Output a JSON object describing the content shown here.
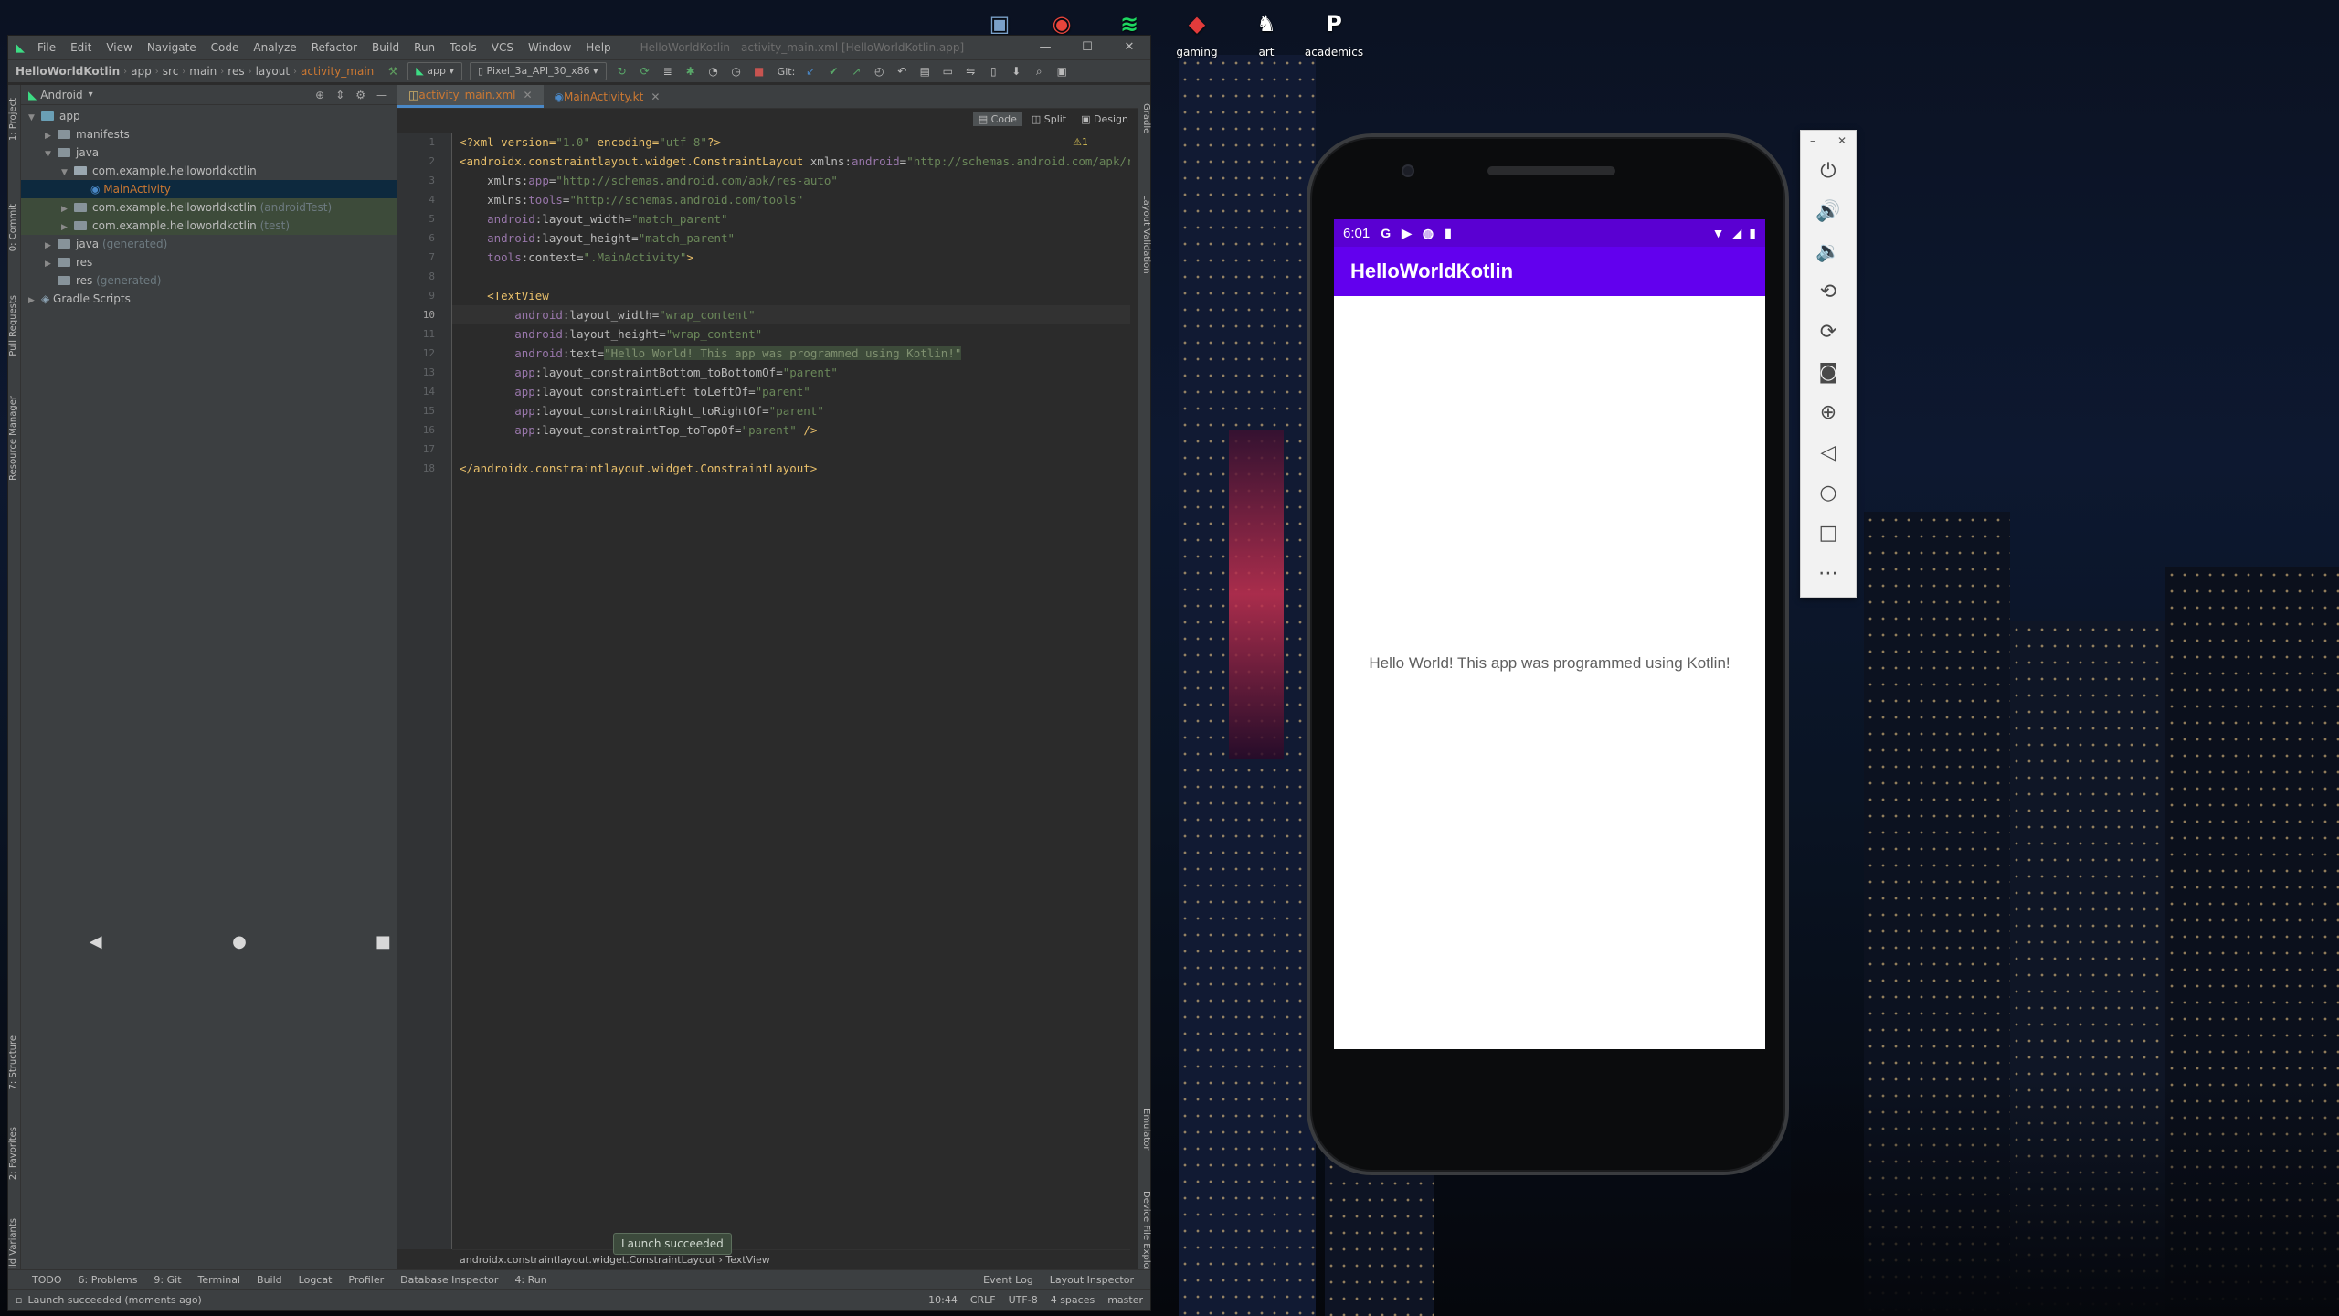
{
  "desktop": {
    "icons": [
      {
        "label": "",
        "glyph": "▣",
        "color": "#7aa0c8",
        "name": "recycle-bin-icon"
      },
      {
        "label": "",
        "glyph": "◉",
        "color": "#e8453c",
        "name": "chrome-icon"
      },
      {
        "label": "",
        "glyph": "≋",
        "color": "#1ed760",
        "name": "spotify-icon"
      },
      {
        "label": "gaming",
        "glyph": "◆",
        "color": "#e23b3b",
        "name": "gaming-icon"
      },
      {
        "label": "art",
        "glyph": "♞",
        "color": "#ffffff",
        "name": "art-icon"
      },
      {
        "label": "academics",
        "glyph": "P",
        "color": "#ffffff",
        "name": "academics-icon"
      }
    ]
  },
  "ide": {
    "menu": [
      "File",
      "Edit",
      "View",
      "Navigate",
      "Code",
      "Analyze",
      "Refactor",
      "Build",
      "Run",
      "Tools",
      "VCS",
      "Window",
      "Help"
    ],
    "title": "HelloWorldKotlin - activity_main.xml [HelloWorldKotlin.app]",
    "window_controls": [
      "—",
      "☐",
      "✕"
    ],
    "breadcrumbs": [
      "HelloWorldKotlin",
      "app",
      "src",
      "main",
      "res",
      "layout",
      "activity_main"
    ],
    "run_config": "app",
    "device": "Pixel_3a_API_30_x86",
    "git_label": "Git:",
    "left_tabs": [
      "1: Project",
      "0: Commit",
      "Pull Requests",
      "Resource Manager",
      "7: Structure",
      "2: Favorites",
      "Build Variants"
    ],
    "right_tabs": [
      "Gradle",
      "Layout Validation",
      "Emulator",
      "Device File Explorer"
    ],
    "project_view": "Android",
    "tree": [
      {
        "indent": 0,
        "arrow": "▼",
        "label": "app",
        "suffix": "",
        "kind": "module"
      },
      {
        "indent": 1,
        "arrow": "▶",
        "label": "manifests",
        "suffix": "",
        "kind": "folder"
      },
      {
        "indent": 1,
        "arrow": "▼",
        "label": "java",
        "suffix": "",
        "kind": "folder"
      },
      {
        "indent": 2,
        "arrow": "▼",
        "label": "com.example.helloworldkotlin",
        "suffix": "",
        "kind": "package"
      },
      {
        "indent": 3,
        "arrow": "",
        "label": "MainActivity",
        "suffix": "",
        "kind": "selected"
      },
      {
        "indent": 2,
        "arrow": "▶",
        "label": "com.example.helloworldkotlin",
        "suffix": " (androidTest)",
        "kind": "test"
      },
      {
        "indent": 2,
        "arrow": "▶",
        "label": "com.example.helloworldkotlin",
        "suffix": " (test)",
        "kind": "test"
      },
      {
        "indent": 1,
        "arrow": "▶",
        "label": "java",
        "suffix": " (generated)",
        "kind": "folder"
      },
      {
        "indent": 1,
        "arrow": "▶",
        "label": "res",
        "suffix": "",
        "kind": "folder"
      },
      {
        "indent": 1,
        "arrow": "",
        "label": "res",
        "suffix": " (generated)",
        "kind": "folder"
      },
      {
        "indent": 0,
        "arrow": "▶",
        "label": "Gradle Scripts",
        "suffix": "",
        "kind": "gradle"
      }
    ],
    "tabs": [
      {
        "label": "activity_main.xml",
        "active": true
      },
      {
        "label": "MainActivity.kt",
        "active": false
      }
    ],
    "view_modes": [
      "Code",
      "Split",
      "Design"
    ],
    "warning_count": "⚠1",
    "current_line": "10",
    "breadcrumb_bar": "androidx.constraintlayout.widget.ConstraintLayout  ›  TextView",
    "launch_tooltip": "Launch succeeded",
    "toolwindows": [
      "TODO",
      "6: Problems",
      "9: Git",
      "Terminal",
      "Build",
      "Logcat",
      "Profiler",
      "Database Inspector",
      "4: Run"
    ],
    "toolwindows_right": [
      "Event Log",
      "Layout Inspector"
    ],
    "status_left": "Launch succeeded (moments ago)",
    "status_right": [
      "10:44",
      "CRLF",
      "UTF-8",
      "4 spaces",
      "master"
    ]
  },
  "code_lines": [
    [
      [
        "tag",
        "<?xml version="
      ],
      [
        "str",
        "\"1.0\""
      ],
      [
        "tag",
        " encoding="
      ],
      [
        "str",
        "\"utf-8\""
      ],
      [
        "tag",
        "?>"
      ]
    ],
    [
      [
        "tag",
        "<androidx.constraintlayout.widget.ConstraintLayout "
      ],
      [
        "attr",
        "xmlns:"
      ],
      [
        "ns",
        "android"
      ],
      [
        "attr",
        "="
      ],
      [
        "str",
        "\"http://schemas.android.com/apk/res/android\""
      ]
    ],
    [
      [
        "attr",
        "    xmlns:"
      ],
      [
        "ns",
        "app"
      ],
      [
        "attr",
        "="
      ],
      [
        "str",
        "\"http://schemas.android.com/apk/res-auto\""
      ]
    ],
    [
      [
        "attr",
        "    xmlns:"
      ],
      [
        "ns",
        "tools"
      ],
      [
        "attr",
        "="
      ],
      [
        "str",
        "\"http://schemas.android.com/tools\""
      ]
    ],
    [
      [
        "ns",
        "    android"
      ],
      [
        "attr",
        ":layout_width="
      ],
      [
        "str",
        "\"match_parent\""
      ]
    ],
    [
      [
        "ns",
        "    android"
      ],
      [
        "attr",
        ":layout_height="
      ],
      [
        "str",
        "\"match_parent\""
      ]
    ],
    [
      [
        "ns",
        "    tools"
      ],
      [
        "attr",
        ":context="
      ],
      [
        "str",
        "\".MainActivity\""
      ],
      [
        "tag",
        ">"
      ]
    ],
    [
      [
        "attr",
        ""
      ]
    ],
    [
      [
        "tag",
        "    <TextView"
      ]
    ],
    [
      [
        "ns",
        "        android"
      ],
      [
        "attr",
        ":layout_width="
      ],
      [
        "str",
        "\"wrap_content\""
      ]
    ],
    [
      [
        "ns",
        "        android"
      ],
      [
        "attr",
        ":layout_height="
      ],
      [
        "str",
        "\"wrap_content\""
      ]
    ],
    [
      [
        "ns",
        "        android"
      ],
      [
        "attr",
        ":text="
      ],
      [
        "hl",
        "\"Hello World! This app was programmed using Kotlin!\""
      ]
    ],
    [
      [
        "ns",
        "        app"
      ],
      [
        "attr",
        ":layout_constraintBottom_toBottomOf="
      ],
      [
        "str",
        "\"parent\""
      ]
    ],
    [
      [
        "ns",
        "        app"
      ],
      [
        "attr",
        ":layout_constraintLeft_toLeftOf="
      ],
      [
        "str",
        "\"parent\""
      ]
    ],
    [
      [
        "ns",
        "        app"
      ],
      [
        "attr",
        ":layout_constraintRight_toRightOf="
      ],
      [
        "str",
        "\"parent\""
      ]
    ],
    [
      [
        "ns",
        "        app"
      ],
      [
        "attr",
        ":layout_constraintTop_toTopOf="
      ],
      [
        "str",
        "\"parent\""
      ],
      [
        "tag",
        " />"
      ]
    ],
    [
      [
        "attr",
        ""
      ]
    ],
    [
      [
        "tag",
        "</androidx.constraintlayout.widget.ConstraintLayout>"
      ]
    ]
  ],
  "emulator": {
    "time": "6:01",
    "status_icons": [
      "G",
      "▶",
      "◍",
      "▮"
    ],
    "status_right": [
      "▼",
      "◢",
      "▮"
    ],
    "app_title": "HelloWorldKotlin",
    "hello_text": "Hello World! This app was programmed using Kotlin!",
    "nav": [
      "◀",
      "●",
      "■"
    ],
    "toolbar_top": [
      "–",
      "✕"
    ],
    "toolbar": [
      {
        "name": "power-icon",
        "glyph": "⏻"
      },
      {
        "name": "volume-up-icon",
        "glyph": "🔊"
      },
      {
        "name": "volume-down-icon",
        "glyph": "🔉"
      },
      {
        "name": "rotate-left-icon",
        "glyph": "⟲"
      },
      {
        "name": "rotate-right-icon",
        "glyph": "⟳"
      },
      {
        "name": "camera-icon",
        "glyph": "◙"
      },
      {
        "name": "zoom-icon",
        "glyph": "⊕"
      },
      {
        "name": "back-icon",
        "glyph": "◁"
      },
      {
        "name": "home-icon",
        "glyph": "○"
      },
      {
        "name": "overview-icon",
        "glyph": "□"
      },
      {
        "name": "more-icon",
        "glyph": "⋯"
      }
    ]
  },
  "colors": {
    "app_bar": "#6200ee",
    "status_bar": "#5a00d2",
    "ide_bg": "#2b2b2b"
  }
}
